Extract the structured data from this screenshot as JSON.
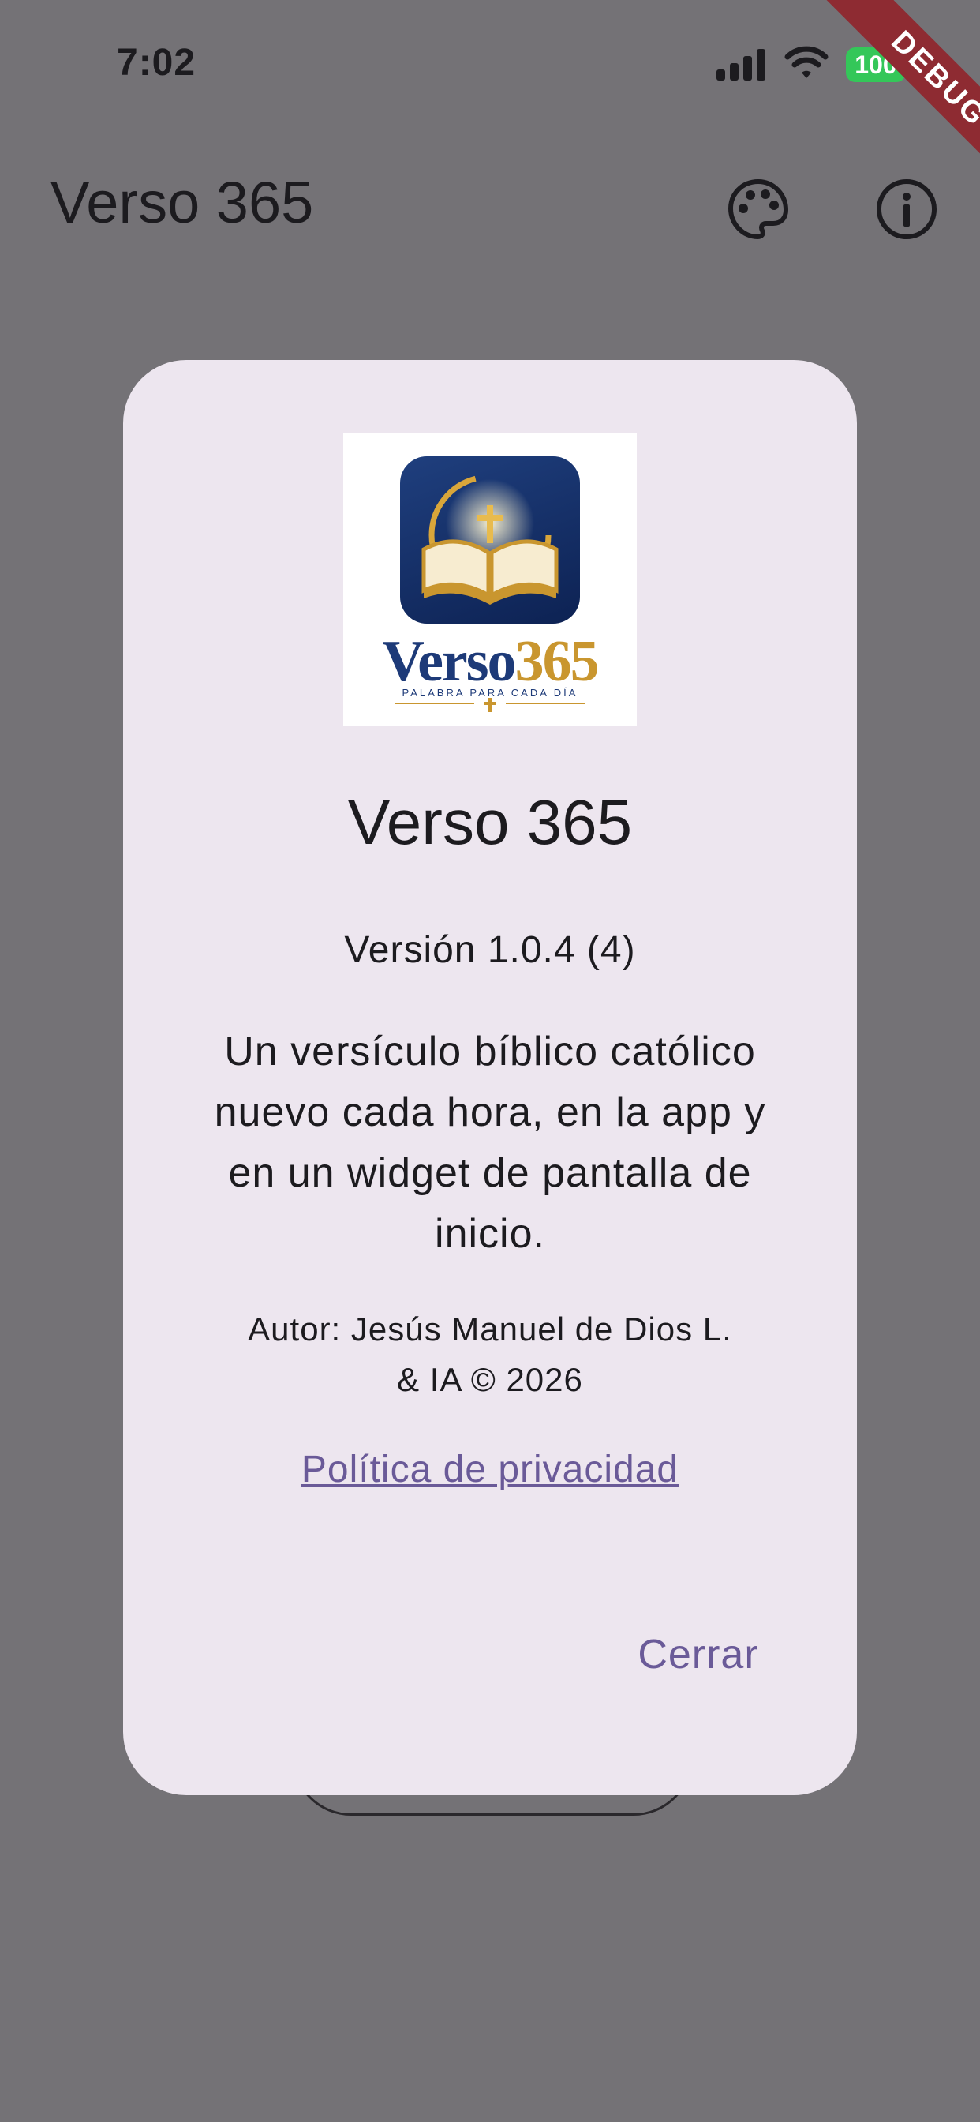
{
  "status_bar": {
    "time": "7:02",
    "battery_level": "100",
    "debug_banner": "DEBUG"
  },
  "app_bar": {
    "title": "Verso 365",
    "actions": [
      "palette-icon",
      "info-icon"
    ]
  },
  "dialog": {
    "logo": {
      "wordmark_part1": "Verso",
      "wordmark_part2": "365",
      "tagline": "PALABRA PARA CADA DÍA"
    },
    "title": "Verso 365",
    "version": "Versión 1.0.4 (4)",
    "description": "Un versículo bíblico católico nuevo cada hora, en la app y en un widget de pantalla de inicio.",
    "author_line1": "Autor: Jesús Manuel de Dios L.",
    "author_line2": "& IA © 2026",
    "privacy_link": "Política de privacidad",
    "close_button": "Cerrar"
  },
  "colors": {
    "scrim": "#747276",
    "dialog_bg": "#ede6ef",
    "accent": "#6a5a98",
    "battery": "#34c759",
    "debug": "#8e2b32",
    "brand_blue": "#1d3a78",
    "brand_gold": "#c9962f"
  }
}
